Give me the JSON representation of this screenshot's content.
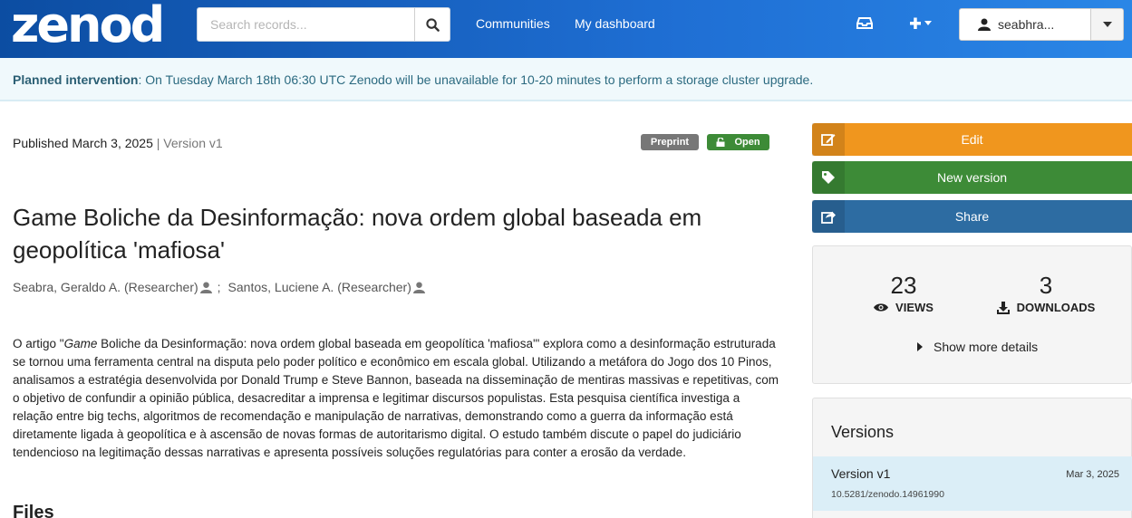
{
  "header": {
    "logo_text": "zenodo",
    "search_placeholder": "Search records...",
    "nav": {
      "communities": "Communities",
      "dashboard": "My dashboard"
    },
    "user": {
      "name": "seabhra..."
    }
  },
  "banner": {
    "label": "Planned intervention",
    "message": ": On Tuesday March 18th 06:30 UTC Zenodo will be unavailable for 10-20 minutes to perform a storage cluster upgrade."
  },
  "record": {
    "published": "Published March 3, 2025",
    "separator": "|",
    "version": "Version v1",
    "badge_type": "Preprint",
    "badge_access": "Open",
    "title": "Game Boliche da Desinformação: nova ordem global baseada em geopolítica 'mafiosa'",
    "authors": [
      {
        "name": "Seabra, Geraldo A. (Researcher)"
      },
      {
        "name": "Santos, Luciene A. (Researcher)"
      }
    ],
    "author_separator": ";",
    "abstract": {
      "prefix": "O artigo \"",
      "italic": "Game",
      "body": " Boliche da Desinformação: nova ordem global baseada em geopolítica 'mafiosa'\" explora como a desinformação estruturada se tornou uma ferramenta central na disputa pelo poder político e econômico em escala global. Utilizando a metáfora do Jogo dos 10 Pinos, analisamos a estratégia desenvolvida por Donald Trump e Steve Bannon, baseada na disseminação de mentiras massivas e repetitivas, com o objetivo de confundir a opinião pública, desacreditar a imprensa e legitimar discursos populistas. Esta pesquisa científica investiga a relação entre big techs, algoritmos de recomendação e manipulação de narrativas, demonstrando como a guerra da informação está diretamente ligada à geopolítica e à ascensão de novas formas de autoritarismo digital. O estudo também discute o papel do judiciário tendencioso na legitimação dessas narrativas e apresenta possíveis soluções regulatórias para conter a erosão da verdade."
    },
    "files_heading": "Files"
  },
  "sidebar": {
    "edit_label": "Edit",
    "new_version_label": "New version",
    "share_label": "Share",
    "stats": {
      "views": "23",
      "views_label": "VIEWS",
      "downloads": "3",
      "downloads_label": "DOWNLOADS",
      "more_details": "Show more details"
    },
    "versions": {
      "title": "Versions",
      "items": [
        {
          "name": "Version v1",
          "date": "Mar 3, 2025",
          "doi": "10.5281/zenodo.14961990"
        }
      ]
    }
  },
  "colors": {
    "header": "#1f6fd4",
    "edit": "#f0961e",
    "new_version": "#3d8b37",
    "share": "#2d6ca2",
    "open_badge": "#3d8b37",
    "preprint_badge": "#777777"
  }
}
